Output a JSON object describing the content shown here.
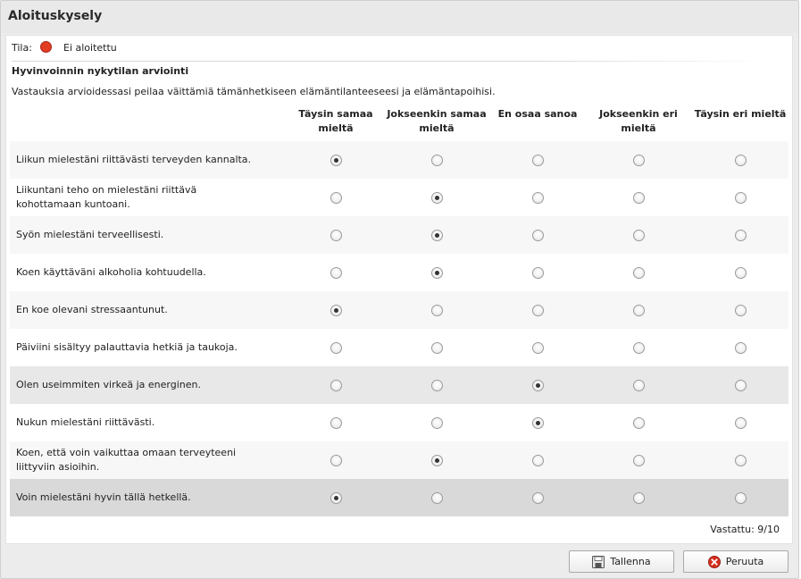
{
  "window": {
    "title": "Aloituskysely"
  },
  "status": {
    "label": "Tila:",
    "value": "Ei aloitettu",
    "color": "#e23d22"
  },
  "section": {
    "title": "Hyvinvoinnin nykytilan arviointi",
    "intro": "Vastauksia arvioidessasi peilaa väittämiä tämänhetkiseen elämäntilanteeseesi ja elämäntapoihisi."
  },
  "columns": [
    {
      "label": "Täysin samaa mieltä"
    },
    {
      "label": "Jokseenkin samaa mieltä"
    },
    {
      "label": "En osaa sanoa"
    },
    {
      "label": "Jokseenkin eri mieltä"
    },
    {
      "label": "Täysin eri mieltä"
    }
  ],
  "questions": [
    {
      "text": "Liikun mielestäni riittävästi terveyden kannalta.",
      "answer": 0,
      "bg": "#f7f7f7"
    },
    {
      "text": "Liikuntani teho on mielestäni riittävä kohottamaan kuntoani.",
      "answer": 1,
      "bg": "#ffffff"
    },
    {
      "text": "Syön mielestäni terveellisesti.",
      "answer": 1,
      "bg": "#f7f7f7"
    },
    {
      "text": "Koen käyttäväni alkoholia kohtuudella.",
      "answer": 1,
      "bg": "#ffffff"
    },
    {
      "text": "En koe olevani stressaantunut.",
      "answer": 0,
      "bg": "#f7f7f7"
    },
    {
      "text": "Päiviini sisältyy palauttavia hetkiä ja taukoja.",
      "answer": null,
      "bg": "#ffffff"
    },
    {
      "text": "Olen useimmiten virkeä ja energinen.",
      "answer": 2,
      "bg": "#e8e8e8"
    },
    {
      "text": "Nukun mielestäni riittävästi.",
      "answer": 2,
      "bg": "#ffffff"
    },
    {
      "text": "Koen, että voin vaikuttaa omaan terveyteeni liittyviin asioihin.",
      "answer": 1,
      "bg": "#f7f7f7"
    },
    {
      "text": "Voin mielestäni hyvin tällä hetkellä.",
      "answer": 0,
      "bg": "#d9d9d9"
    }
  ],
  "answered": "Vastattu: 9/10",
  "buttons": {
    "save": "Tallenna",
    "cancel": "Peruuta"
  },
  "icons": {
    "save": "save-disk-icon",
    "cancel": "cancel-x-icon"
  }
}
